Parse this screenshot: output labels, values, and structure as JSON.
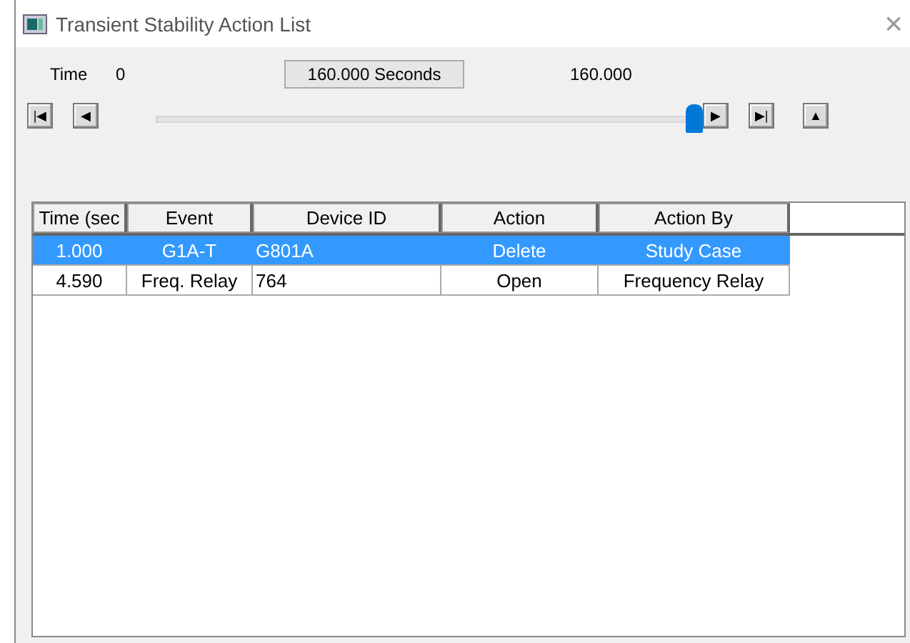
{
  "window": {
    "title": "Transient Stability Action List",
    "close": "×"
  },
  "time_bar": {
    "label": "Time",
    "start": "0",
    "current": "160.000 Seconds",
    "end": "160.000",
    "level": 1.0
  },
  "buttons": [
    {
      "kind": "first",
      "glyph": "|◀"
    },
    {
      "kind": "prev",
      "glyph": "◀"
    },
    {
      "kind": "next",
      "glyph": "▶"
    },
    {
      "kind": "last",
      "glyph": "▶|"
    },
    {
      "kind": "up",
      "glyph": "▲"
    }
  ],
  "table": {
    "columns": [
      {
        "label": "Time (sec"
      },
      {
        "label": "Event"
      },
      {
        "label": "Device ID"
      },
      {
        "label": "Action"
      },
      {
        "label": "Action By"
      }
    ],
    "rows": [
      {
        "selected": true,
        "cells": [
          "1.000",
          "G1A-T",
          "G801A",
          "Delete",
          "Study Case"
        ]
      },
      {
        "selected": false,
        "cells": [
          "4.590",
          "Freq. Relay",
          "764",
          "Open",
          "Frequency Relay"
        ]
      }
    ]
  }
}
